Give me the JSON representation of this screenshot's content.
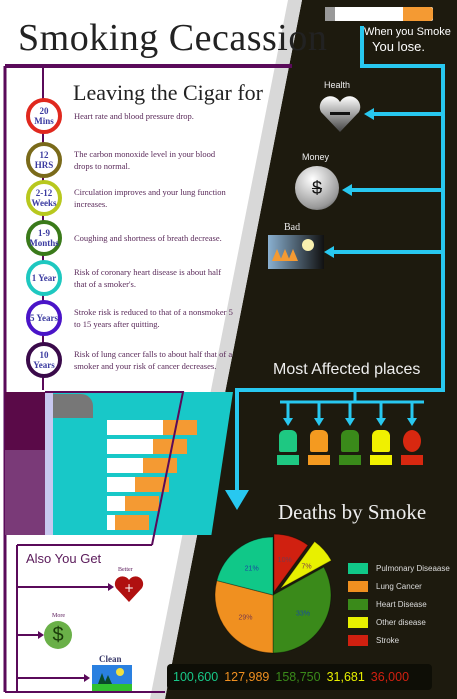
{
  "title": "Smoking Cecassion",
  "left": {
    "subtitle": "Leaving the Cigar for",
    "timeline": [
      {
        "label": "20 Mins",
        "text": "Heart rate and blood pressure drop.",
        "color": "#e0281e"
      },
      {
        "label": "12 HRS",
        "text": "The carbon monoxide level in your blood drops to normal.",
        "color": "#7a6a1a"
      },
      {
        "label": "2-12 Weeks",
        "text": "Circulation improves and your lung function increases.",
        "color": "#b8c81e"
      },
      {
        "label": "1-9 Months",
        "text": "Coughing and shortness of breath decrease.",
        "color": "#3a7a1a"
      },
      {
        "label": "1 Year",
        "text": "Risk of coronary heart disease is about half that of a smoker's.",
        "color": "#1ec8c0"
      },
      {
        "label": "5 Years",
        "text": "Stroke risk is reduced to that of a nonsmoker 5 to 15 years after quitting.",
        "color": "#4a14c8"
      },
      {
        "label": "10 Years",
        "text": "Risk of lung cancer falls to about half that of a smoker and your risk of cancer decreases.",
        "color": "#3a0a4a"
      }
    ],
    "also_title": "Also You Get",
    "benefits": [
      {
        "label": "Better"
      },
      {
        "label": "More"
      },
      {
        "label": "Clean"
      }
    ]
  },
  "right": {
    "tagline1": "When you Smoke",
    "tagline2": "You lose.",
    "losses": [
      {
        "label": "Health"
      },
      {
        "label": "Money"
      },
      {
        "label": "Bad"
      }
    ],
    "affected_title": "Most Affected places",
    "affected_colors": [
      "#1ec882",
      "#f49a20",
      "#3a8a1a",
      "#f0f000",
      "#d82810"
    ]
  },
  "chart_data": {
    "type": "pie",
    "title": "Deaths by Smoke",
    "categories": [
      "Pulmonary Diseaase",
      "Lung Cancer",
      "Heart Disease",
      "Other disease",
      "Stroke"
    ],
    "values": [
      100600,
      127989,
      158750,
      31681,
      36000
    ],
    "value_labels": [
      "100,600",
      "127,989",
      "158,750",
      "31,681",
      "36,000"
    ],
    "percent_labels": [
      "21%",
      "29%",
      "33%",
      "7%",
      "10%"
    ],
    "percents": [
      21,
      29,
      33,
      7,
      10
    ],
    "colors": [
      "#10c888",
      "#f09020",
      "#3a8a1a",
      "#e8f000",
      "#d02010"
    ],
    "legend_position": "right"
  }
}
